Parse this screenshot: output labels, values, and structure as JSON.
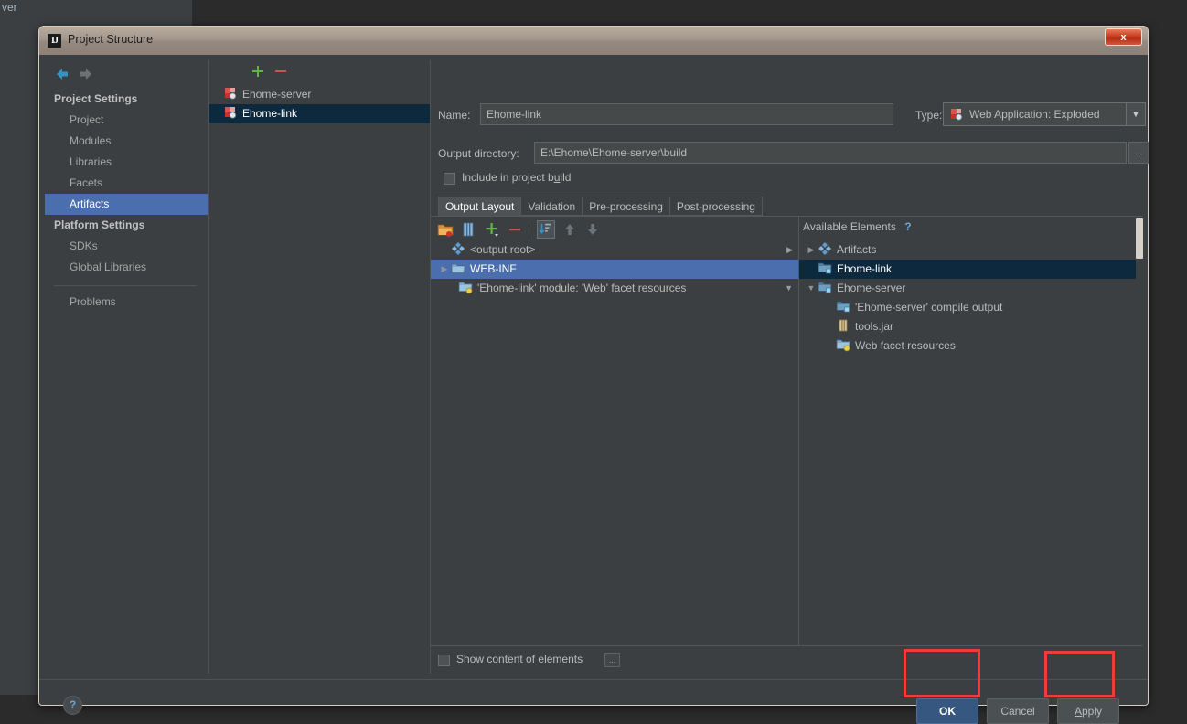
{
  "background": {
    "partial_label": "ver"
  },
  "dialog": {
    "title": "Project Structure",
    "app_icon": "IJ",
    "close_label": "x"
  },
  "sidebar": {
    "nav": {
      "back_icon": "arrow-left-icon",
      "forward_icon": "arrow-right-icon"
    },
    "groups": [
      {
        "label": "Project Settings",
        "items": [
          {
            "label": "Project",
            "selected": false
          },
          {
            "label": "Modules",
            "selected": false
          },
          {
            "label": "Libraries",
            "selected": false
          },
          {
            "label": "Facets",
            "selected": false
          },
          {
            "label": "Artifacts",
            "selected": true
          }
        ]
      },
      {
        "label": "Platform Settings",
        "items": [
          {
            "label": "SDKs",
            "selected": false
          },
          {
            "label": "Global Libraries",
            "selected": false
          }
        ]
      }
    ],
    "extra_item": {
      "label": "Problems"
    }
  },
  "artifacts_panel": {
    "toolbar": {
      "add_label": "+",
      "remove_label": "–"
    },
    "items": [
      {
        "label": "Ehome-server",
        "icon": "artifact-icon",
        "selected": false
      },
      {
        "label": "Ehome-link",
        "icon": "artifact-icon",
        "selected": true
      }
    ]
  },
  "editor": {
    "name_label": "Name:",
    "name_value": "Ehome-link",
    "type_label": "Type:",
    "type_value": "Web Application: Exploded",
    "type_icon": "artifact-icon",
    "output_dir_label": "Output directory:",
    "output_dir_value": "E:\\Ehome\\Ehome-server\\build",
    "browse_label": "...",
    "include_in_build_label": "Include in project build",
    "include_in_build_checked": false,
    "tabs": [
      {
        "label": "Output Layout",
        "active": true
      },
      {
        "label": "Validation",
        "active": false
      },
      {
        "label": "Pre-processing",
        "active": false
      },
      {
        "label": "Post-processing",
        "active": false
      }
    ],
    "layout_toolbar": [
      {
        "name": "add-directory-icon",
        "toggled": false
      },
      {
        "name": "add-archive-icon",
        "toggled": false
      },
      {
        "name": "add-copy-of-icon",
        "toggled": false
      },
      {
        "name": "remove-element-icon",
        "toggled": false
      },
      {
        "name": "sort-elements-icon",
        "toggled": true
      },
      {
        "name": "move-up-icon",
        "toggled": false
      },
      {
        "name": "move-down-icon",
        "toggled": false
      }
    ],
    "output_tree": [
      {
        "label": "<output root>",
        "icon": "artifacts-root-icon",
        "indent": 0,
        "twisty": "",
        "selected": false
      },
      {
        "label": "WEB-INF",
        "icon": "folder-icon",
        "indent": 0,
        "twisty": "▶",
        "selected": true
      },
      {
        "label": "'Ehome-link' module: 'Web' facet resources",
        "icon": "facet-resources-icon",
        "indent": 1,
        "twisty": "",
        "selected": false
      }
    ],
    "available_header": "Available Elements",
    "available_help_icon": "?",
    "available_tree": [
      {
        "label": "Artifacts",
        "icon": "artifacts-root-icon",
        "indent": 0,
        "twisty": "▶",
        "selected": false
      },
      {
        "label": "Ehome-link",
        "icon": "module-icon",
        "indent": 1,
        "twisty": "",
        "selected": true
      },
      {
        "label": "Ehome-server",
        "icon": "module-icon",
        "indent": 0,
        "twisty": "▼",
        "selected": false
      },
      {
        "label": "'Ehome-server' compile output",
        "icon": "compile-output-icon",
        "indent": 2,
        "twisty": "",
        "selected": false
      },
      {
        "label": "tools.jar",
        "icon": "jar-icon",
        "indent": 2,
        "twisty": "",
        "selected": false
      },
      {
        "label": "Web facet resources",
        "icon": "facet-resources-icon",
        "indent": 2,
        "twisty": "",
        "selected": false
      }
    ],
    "show_content_label": "Show content of elements",
    "show_content_checked": false,
    "show_content_more_label": "..."
  },
  "footer": {
    "help_label": "?",
    "ok_label": "OK",
    "cancel_label": "Cancel",
    "apply_label": "Apply"
  },
  "colors": {
    "accent_selection": "#4b6eaf",
    "selection_unfocused": "#0d293e",
    "dialog_bg": "#3c3f41",
    "annotation": "#f03b3b",
    "link_blue": "#6aa4d8",
    "ok_button": "#365880"
  }
}
